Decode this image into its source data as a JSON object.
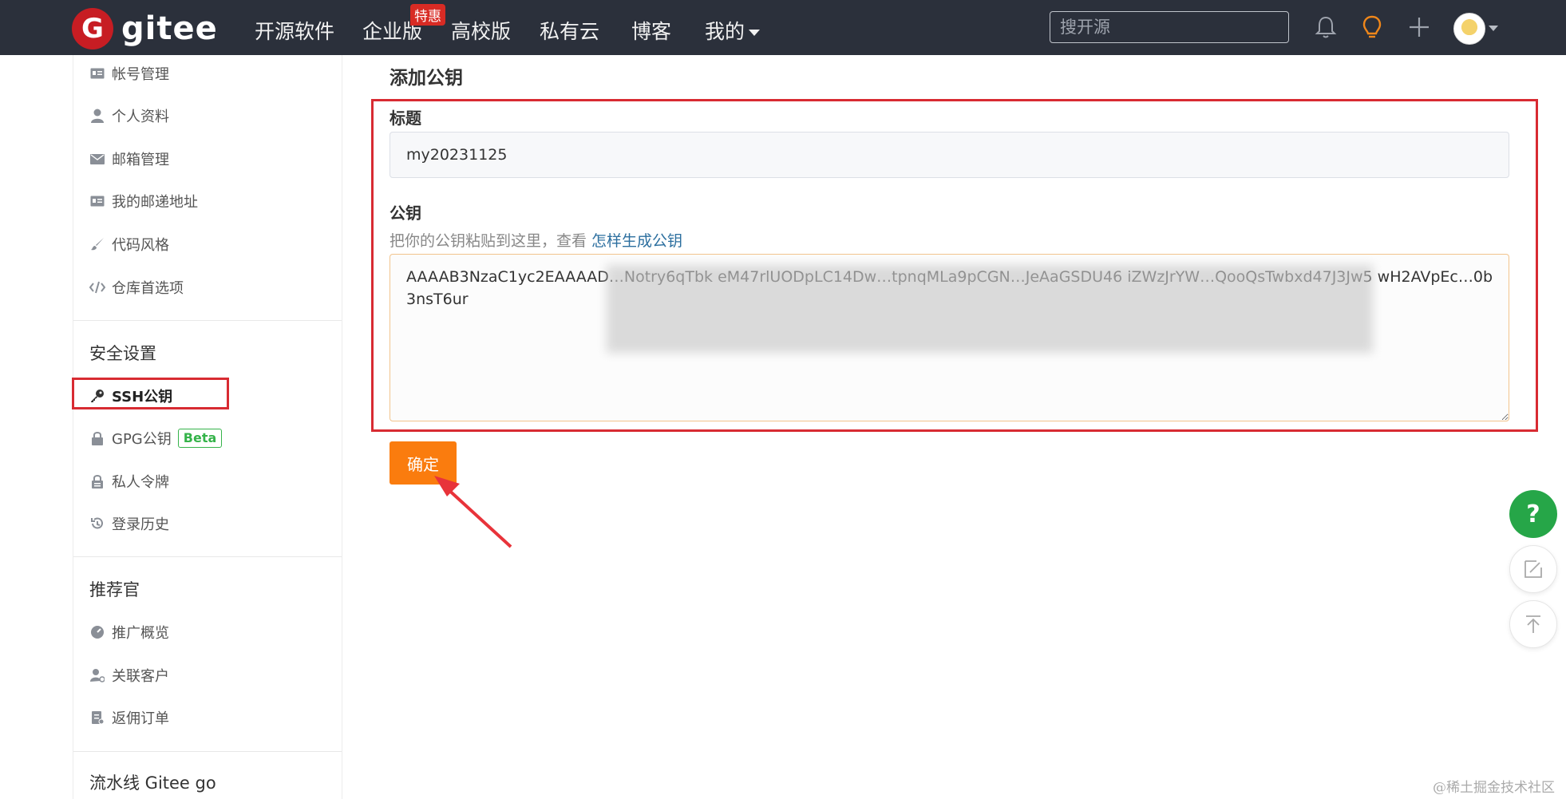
{
  "nav": {
    "logo_letter": "G",
    "logo_text": "gitee",
    "items": [
      "开源软件",
      "企业版",
      "高校版",
      "私有云",
      "博客",
      "我的"
    ],
    "badge": "特惠",
    "search_placeholder": "搜开源"
  },
  "sidebar": {
    "account_items": [
      "帐号管理",
      "个人资料",
      "邮箱管理",
      "我的邮递地址",
      "代码风格",
      "仓库首选项"
    ],
    "security_heading": "安全设置",
    "security_items": [
      "SSH公钥",
      "GPG公钥",
      "私人令牌",
      "登录历史"
    ],
    "gpg_badge": "Beta",
    "referral_heading": "推荐官",
    "referral_items": [
      "推广概览",
      "关联客户",
      "返佣订单"
    ],
    "pipeline_heading": "流水线 Gitee go"
  },
  "form": {
    "page_title": "添加公钥",
    "title_label": "标题",
    "title_value": "my20231125",
    "key_label": "公钥",
    "hint_text": "把你的公钥粘贴到这里，查看 ",
    "hint_link": "怎样生成公钥",
    "key_value": "AAAAB3NzaC1yc2EAAAAD…Notry6qTbk eM47rlUODpLC14Dw…tpnqMLa9pCGN…JeAaGSDU46 iZWzJrYW…QooQsTwbxd47J3Jw5 wH2AVpEc…0b3nsT6ur",
    "confirm_label": "确定"
  },
  "float": {
    "help_label": "?"
  },
  "watermark": "@稀土掘金技术社区",
  "colors": {
    "topbar": "#2b303b",
    "brand_red": "#c71d23",
    "confirm_orange": "#fa7c0e",
    "highlight_red": "#d82b32",
    "help_green": "#26a648",
    "link_blue": "#2c6f9f"
  }
}
